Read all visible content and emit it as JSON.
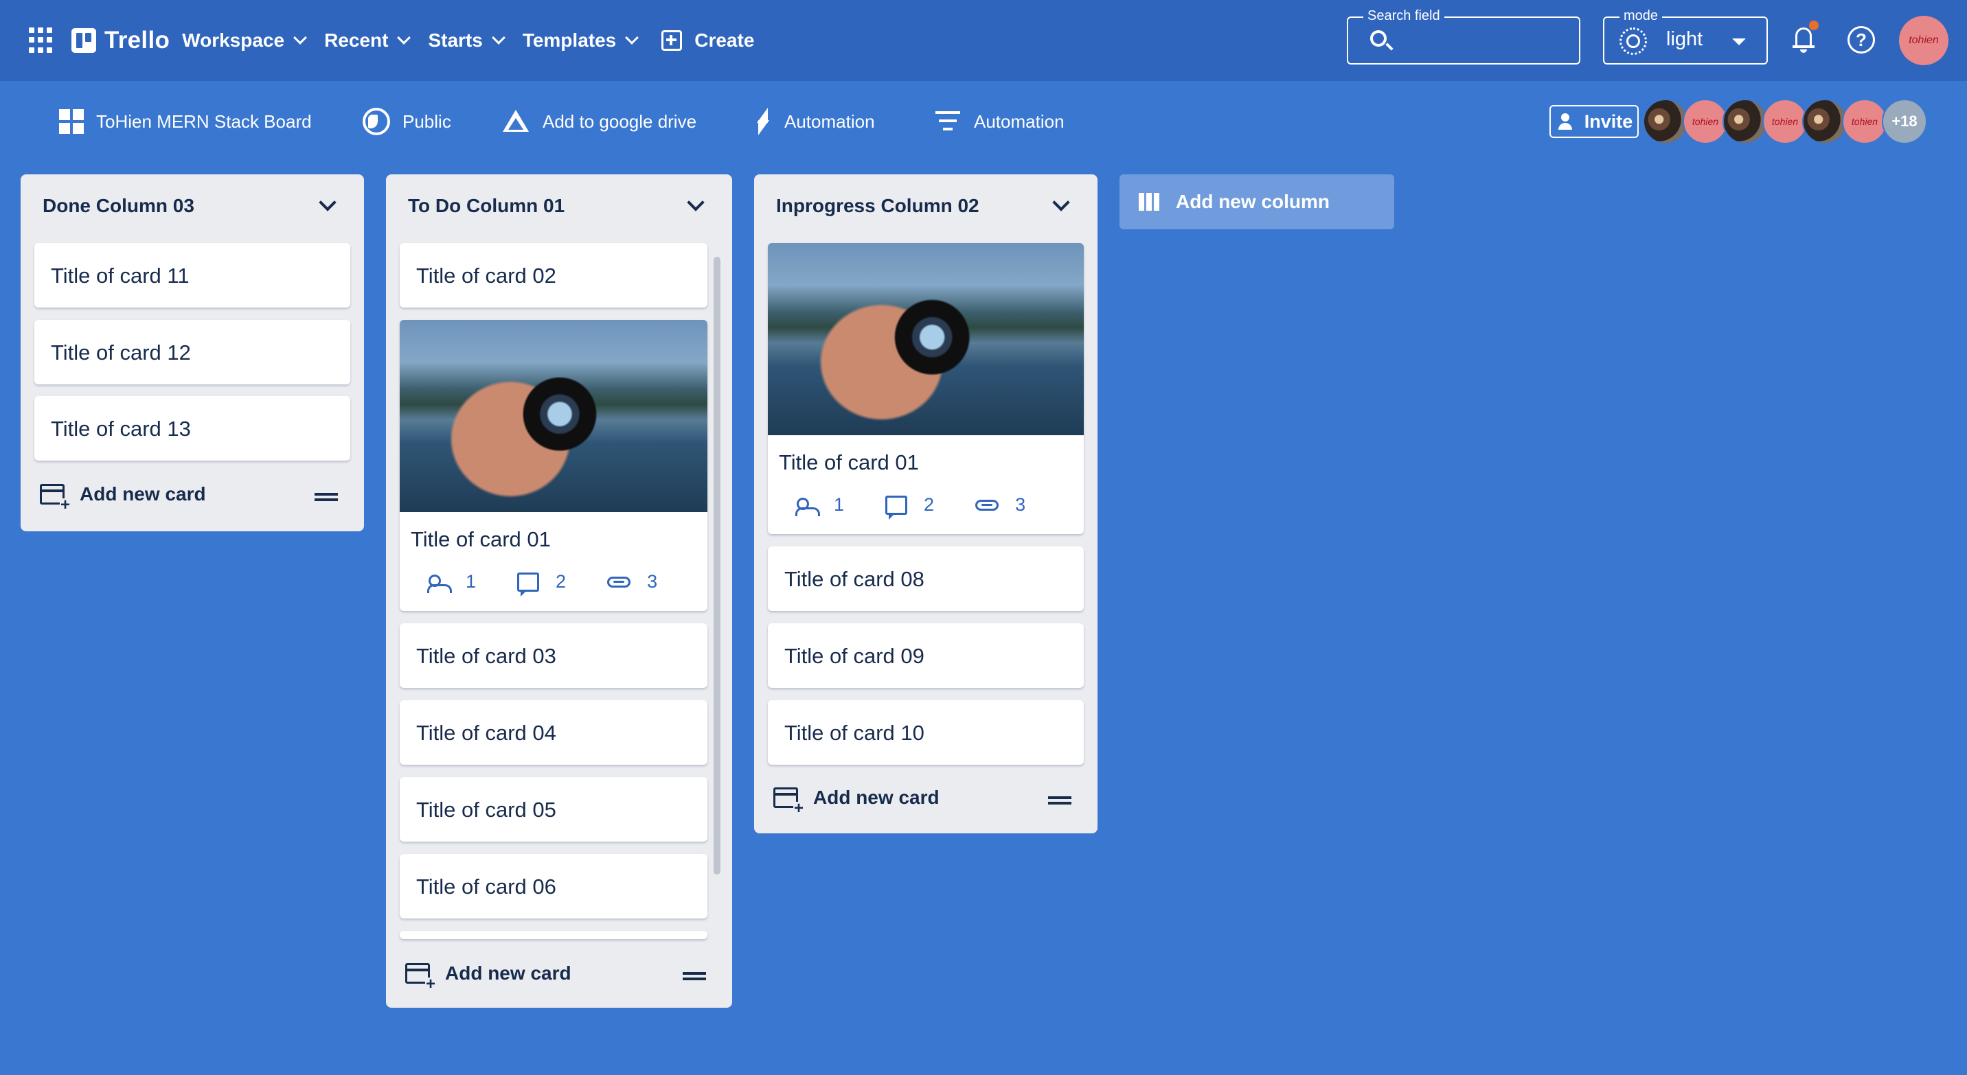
{
  "appbar": {
    "brand": "Trello",
    "menus": [
      "Workspace",
      "Recent",
      "Starts",
      "Templates"
    ],
    "create_label": "Create",
    "search": {
      "legend": "Search field",
      "value": ""
    },
    "mode": {
      "legend": "mode",
      "value": "light"
    },
    "profile_avatar_text": "tohien"
  },
  "boardbar": {
    "board_name": "ToHien MERN Stack Board",
    "visibility": "Public",
    "drive": "Add to google drive",
    "automation": "Automation",
    "filters": "Automation",
    "invite": "Invite",
    "avatars_more": "+18",
    "avatar_text": "tohien"
  },
  "columns": [
    {
      "title": "Done Column 03",
      "cards": [
        "Title of card 11",
        "Title of card 12",
        "Title of card 13"
      ],
      "add_card": "Add new card"
    },
    {
      "title": "To Do Column 01",
      "cards": [
        "Title of card 02",
        "Title of card 01",
        "Title of card 03",
        "Title of card 04",
        "Title of card 05",
        "Title of card 06"
      ],
      "cover_card_meta": {
        "members": "1",
        "comments": "2",
        "attachments": "3"
      },
      "add_card": "Add new card"
    },
    {
      "title": "Inprogress Column 02",
      "cards": [
        "Title of card 01",
        "Title of card 08",
        "Title of card 09",
        "Title of card 10"
      ],
      "cover_card_meta": {
        "members": "1",
        "comments": "2",
        "attachments": "3"
      },
      "add_card": "Add new card"
    }
  ],
  "add_column": "Add new column",
  "colors": {
    "appbar_bg": "#2f65bd",
    "board_bg": "#3a77d0",
    "column_bg": "#ebecf0",
    "meta_accent": "#2f65bd",
    "notification_dot": "#e86f2a",
    "avatar_pink": "#e8878a"
  }
}
